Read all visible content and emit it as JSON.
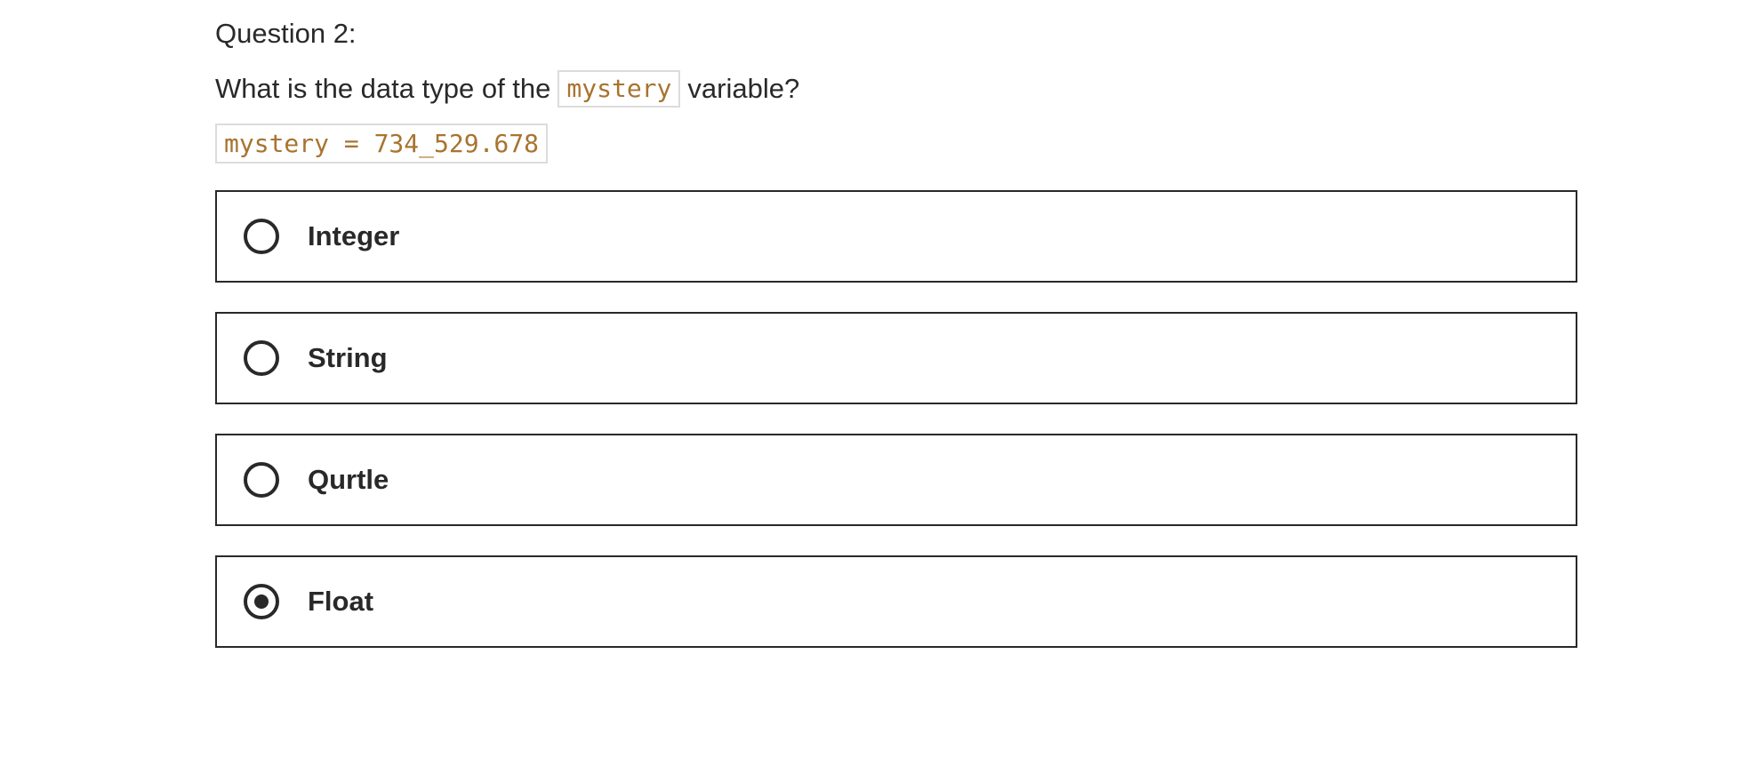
{
  "question": {
    "number_label": "Question 2:",
    "prompt_before": "What is the data type of the",
    "prompt_code": "mystery",
    "prompt_after": "variable?",
    "code_snippet": "mystery = 734_529.678"
  },
  "options": [
    {
      "label": "Integer",
      "selected": false
    },
    {
      "label": "String",
      "selected": false
    },
    {
      "label": "Qurtle",
      "selected": false
    },
    {
      "label": "Float",
      "selected": true
    }
  ],
  "colors": {
    "text": "#292929",
    "code": "#a8742f",
    "code_border": "#dcdcdc"
  }
}
